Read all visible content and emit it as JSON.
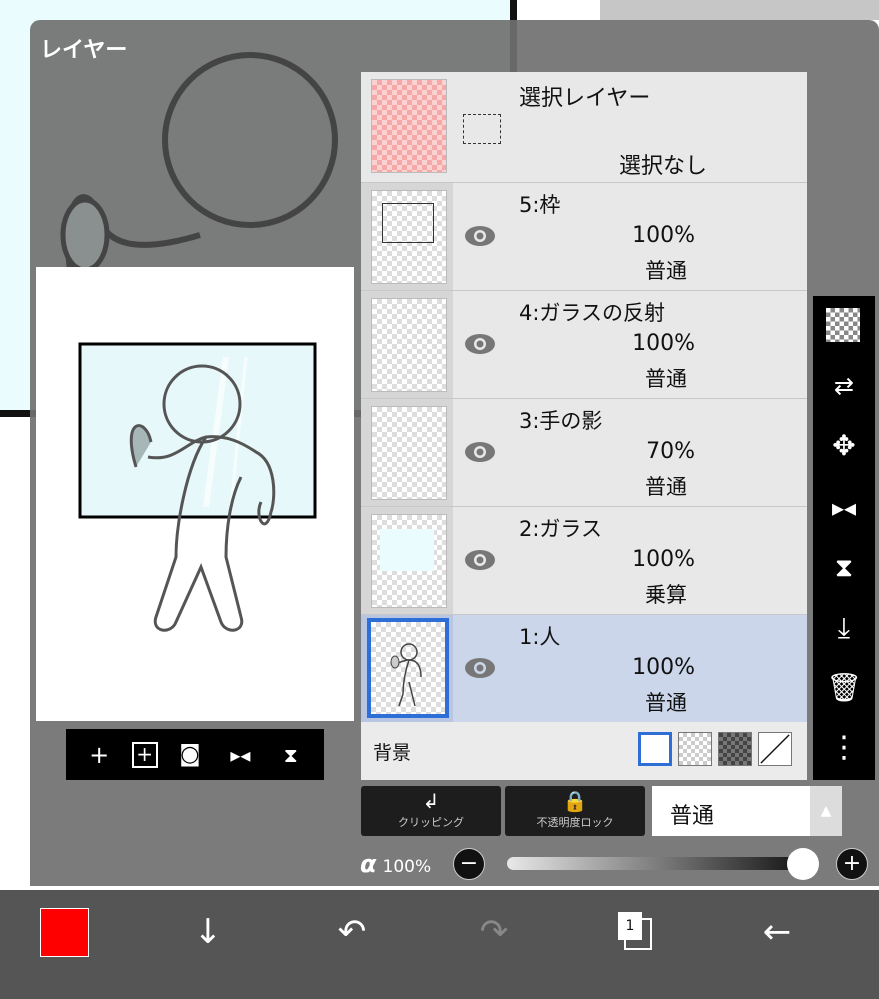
{
  "panel": {
    "title": "レイヤー"
  },
  "thumb_tools": [
    "+",
    "⊞",
    "📷",
    "⇋",
    "⇅"
  ],
  "selection_layer": {
    "name": "選択レイヤー",
    "status": "選択なし"
  },
  "layers": [
    {
      "name": "5:枠",
      "opacity": "100%",
      "mode": "普通"
    },
    {
      "name": "4:ガラスの反射",
      "opacity": "100%",
      "mode": "普通"
    },
    {
      "name": "3:手の影",
      "opacity": "70%",
      "mode": "普通"
    },
    {
      "name": "2:ガラス",
      "opacity": "100%",
      "mode": "乗算"
    },
    {
      "name": "1:人",
      "opacity": "100%",
      "mode": "普通"
    }
  ],
  "background": {
    "label": "背景",
    "swatches": [
      "white",
      "transparent",
      "dark-checker",
      "diagonal"
    ]
  },
  "controls": {
    "clipping_label": "クリッピング",
    "opacity_lock_label": "不透明度ロック",
    "blend_mode": "普通",
    "alpha_symbol": "α",
    "alpha_value": "100%",
    "alpha_level": 1.0
  },
  "bottom": {
    "current_color": "#ff0000",
    "page_number": "1"
  },
  "colors": {
    "accent": "#2d6fd6",
    "active_row": "#cbd6ea"
  }
}
